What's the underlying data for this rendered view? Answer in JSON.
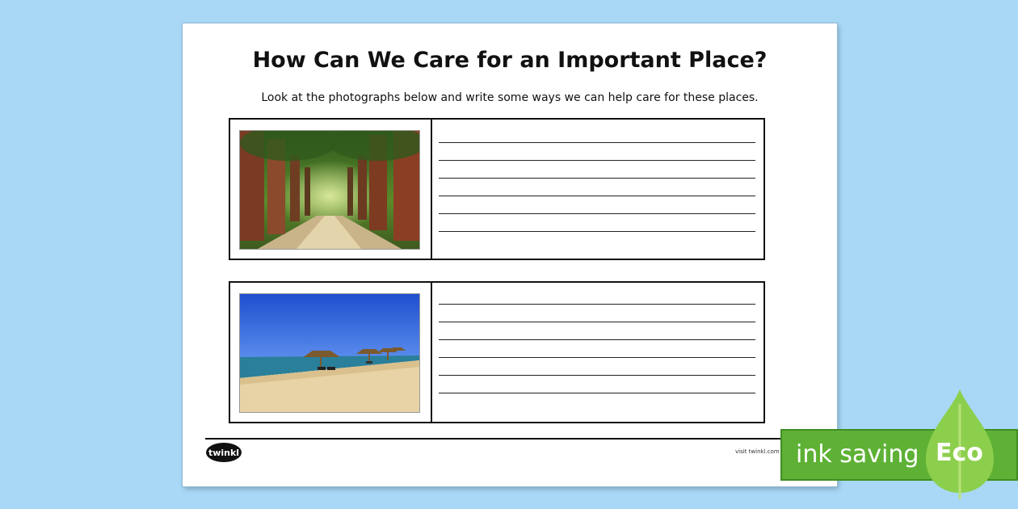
{
  "worksheet": {
    "title": "How Can We Care for an Important Place?",
    "instructions": "Look at the photographs below and write some ways we can help care for these places.",
    "activities": [
      {
        "photo_subject": "forest path with tall trees",
        "writing_lines": 6
      },
      {
        "photo_subject": "sandy beach with thatched umbrellas",
        "writing_lines": 6
      }
    ]
  },
  "footer": {
    "logo": "twinkl",
    "url_text": "visit twinkl.com"
  },
  "badge": {
    "text": "ink saving",
    "label": "Eco",
    "colors": {
      "green": "#5eb135",
      "leaf": "#8ccf4d"
    }
  }
}
